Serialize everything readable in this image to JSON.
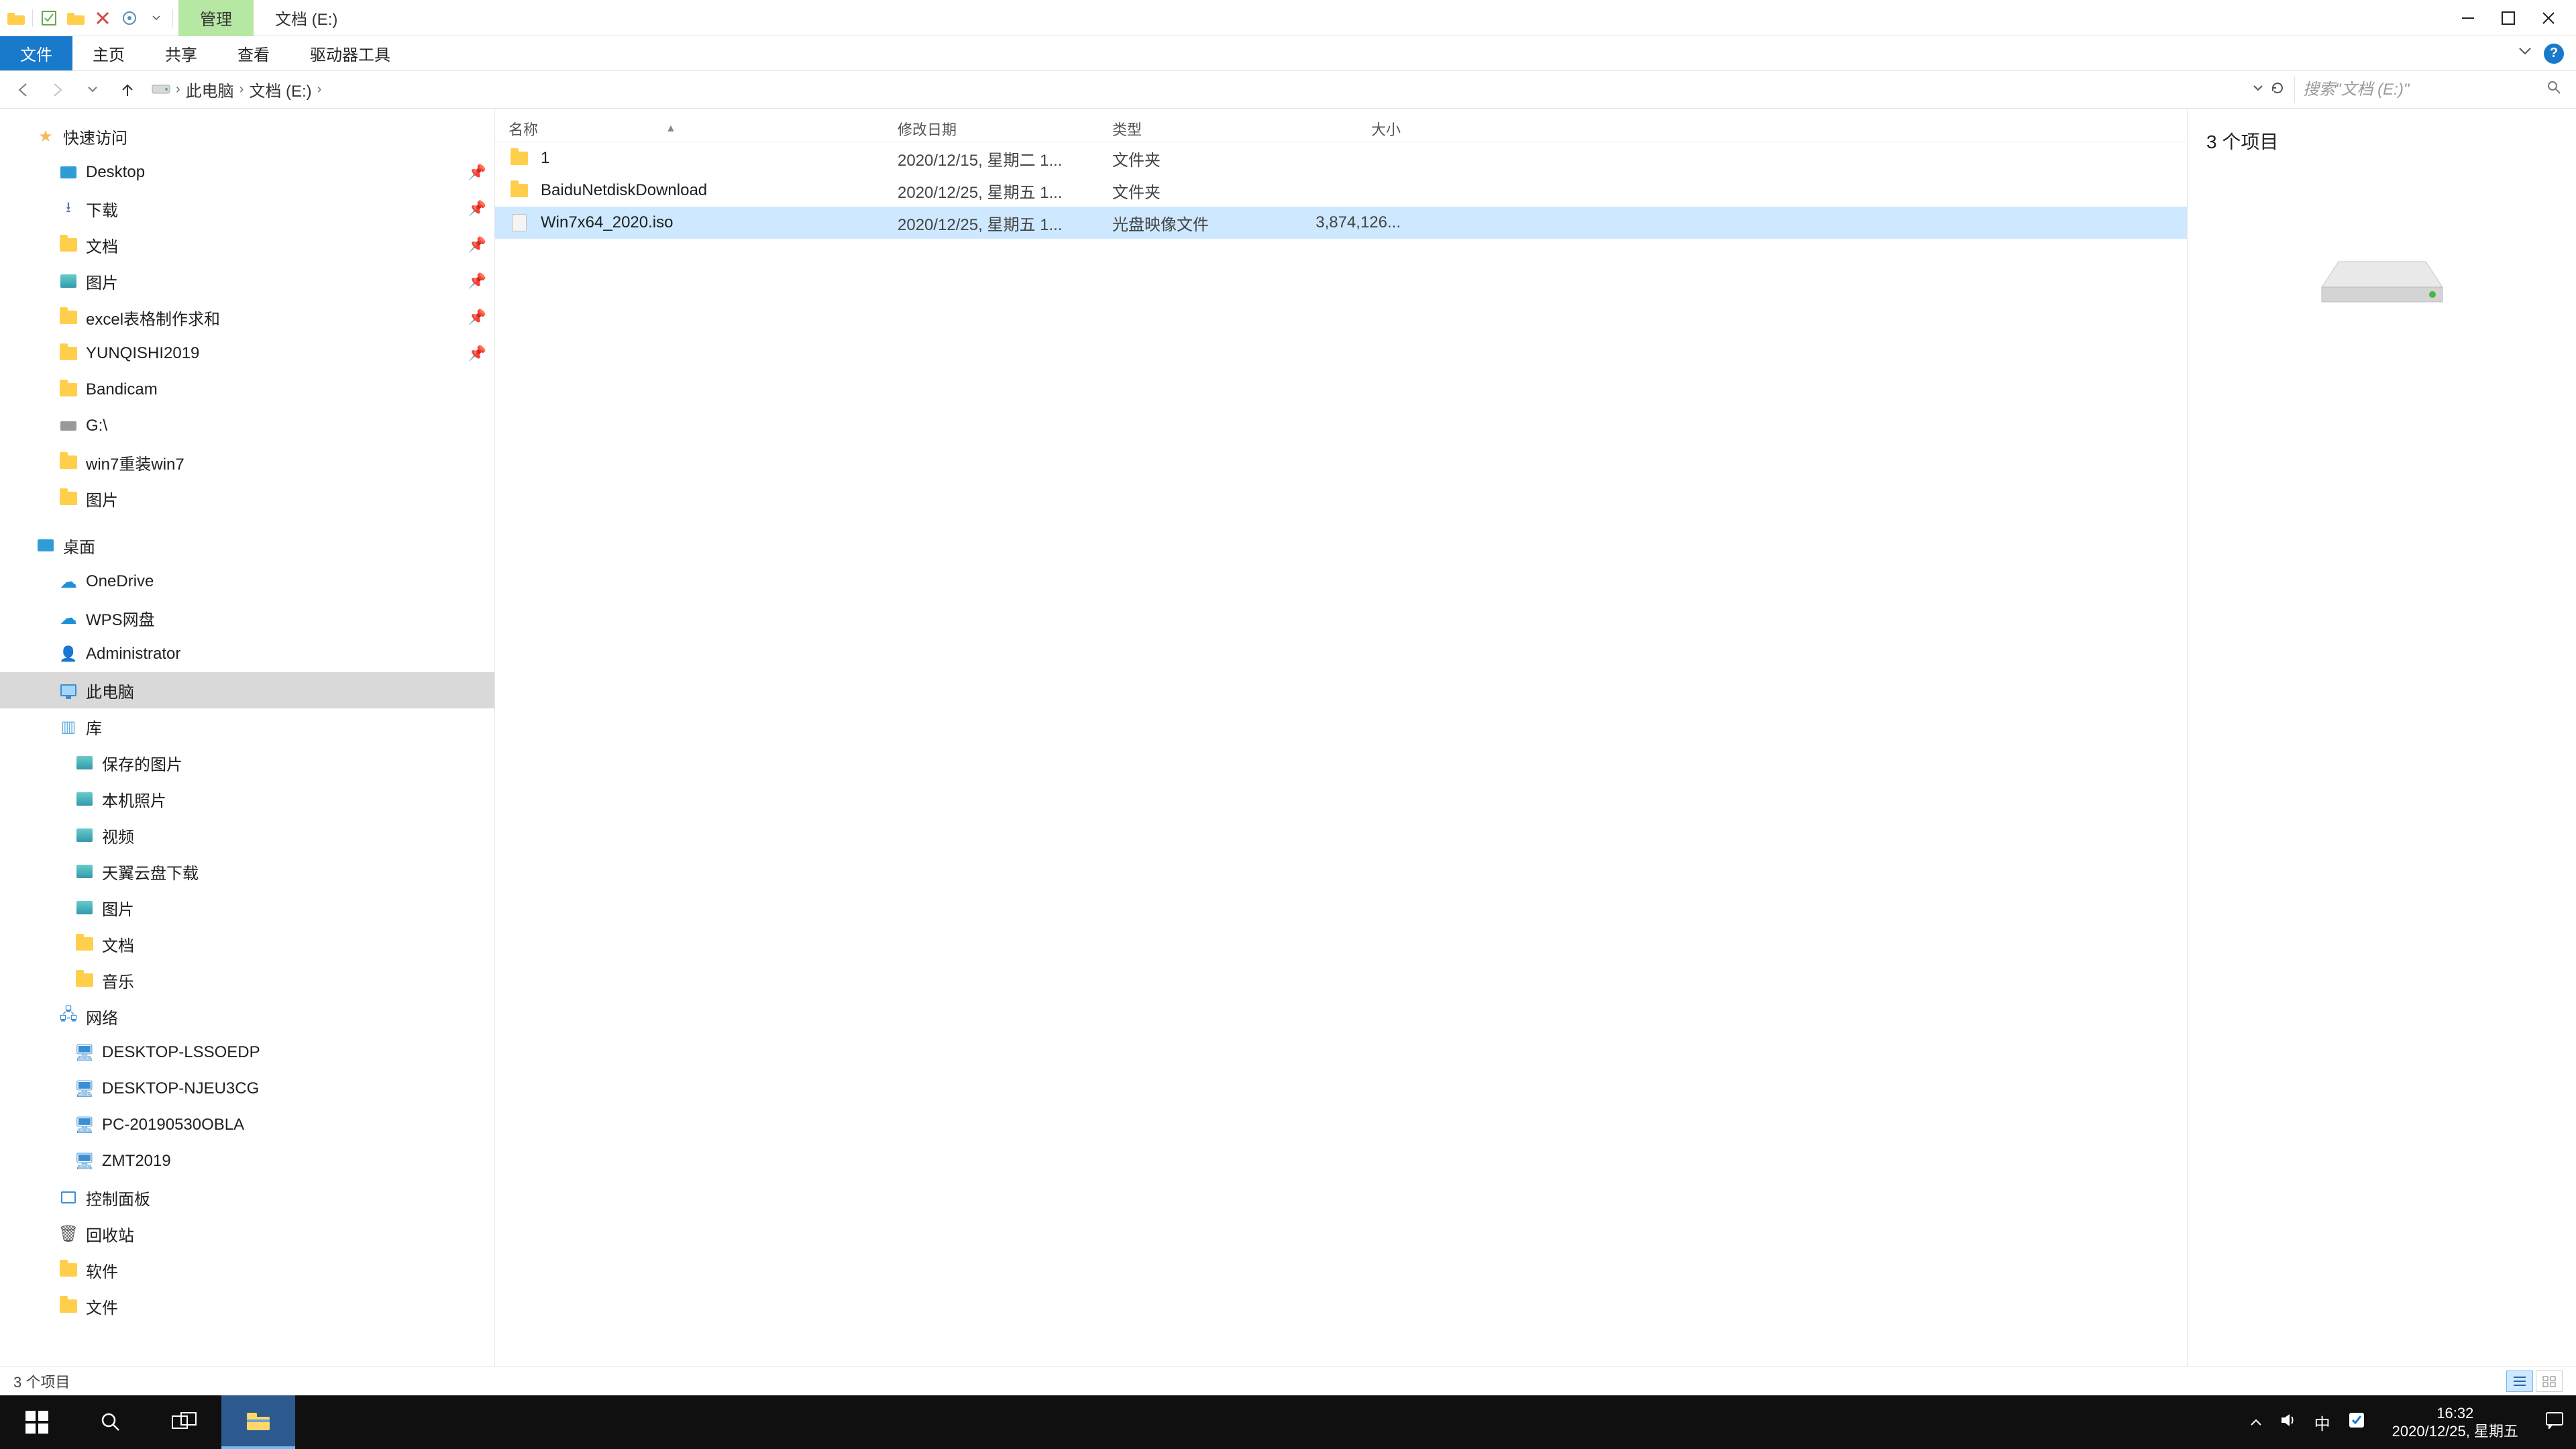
{
  "titlebar": {
    "manage_tab": "管理",
    "path_tab": "文档 (E:)"
  },
  "ribbon": {
    "file": "文件",
    "home": "主页",
    "share": "共享",
    "view": "查看",
    "drive_tools": "驱动器工具"
  },
  "breadcrumbs": {
    "this_pc": "此电脑",
    "drive": "文档 (E:)"
  },
  "search": {
    "placeholder": "搜索\"文档 (E:)\""
  },
  "columns": {
    "name": "名称",
    "date": "修改日期",
    "type": "类型",
    "size": "大小"
  },
  "rows": [
    {
      "name": "1",
      "date": "2020/12/15, 星期二 1...",
      "type": "文件夹",
      "size": "",
      "icon": "folder",
      "selected": false
    },
    {
      "name": "BaiduNetdiskDownload",
      "date": "2020/12/25, 星期五 1...",
      "type": "文件夹",
      "size": "",
      "icon": "folder",
      "selected": false
    },
    {
      "name": "Win7x64_2020.iso",
      "date": "2020/12/25, 星期五 1...",
      "type": "光盘映像文件",
      "size": "3,874,126...",
      "icon": "file",
      "selected": true
    }
  ],
  "nav": {
    "quick_access": "快速访问",
    "quick": [
      {
        "label": "Desktop",
        "icon": "desktop",
        "pin": true
      },
      {
        "label": "下载",
        "icon": "down",
        "pin": true
      },
      {
        "label": "文档",
        "icon": "folder",
        "pin": true
      },
      {
        "label": "图片",
        "icon": "img",
        "pin": true
      },
      {
        "label": "excel表格制作求和",
        "icon": "folder",
        "pin": true
      },
      {
        "label": "YUNQISHI2019",
        "icon": "folder",
        "pin": true
      },
      {
        "label": "Bandicam",
        "icon": "folder",
        "pin": false
      },
      {
        "label": "G:\\",
        "icon": "usb",
        "pin": false
      },
      {
        "label": "win7重装win7",
        "icon": "folder",
        "pin": false
      },
      {
        "label": "图片",
        "icon": "folder",
        "pin": false
      }
    ],
    "desktop_root": "桌面",
    "desktop": [
      {
        "label": "OneDrive",
        "icon": "onedrive"
      },
      {
        "label": "WPS网盘",
        "icon": "onedrive"
      },
      {
        "label": "Administrator",
        "icon": "user"
      },
      {
        "label": "此电脑",
        "icon": "monitor",
        "selected": true
      },
      {
        "label": "库",
        "icon": "lib"
      }
    ],
    "libraries": [
      {
        "label": "保存的图片",
        "icon": "img"
      },
      {
        "label": "本机照片",
        "icon": "img"
      },
      {
        "label": "视频",
        "icon": "img"
      },
      {
        "label": "天翼云盘下载",
        "icon": "img"
      },
      {
        "label": "图片",
        "icon": "img"
      },
      {
        "label": "文档",
        "icon": "folder"
      },
      {
        "label": "音乐",
        "icon": "folder"
      }
    ],
    "network_root": "网络",
    "network": [
      {
        "label": "DESKTOP-LSSOEDP",
        "icon": "pc"
      },
      {
        "label": "DESKTOP-NJEU3CG",
        "icon": "pc"
      },
      {
        "label": "PC-20190530OBLA",
        "icon": "pc"
      },
      {
        "label": "ZMT2019",
        "icon": "pc"
      }
    ],
    "extra": [
      {
        "label": "控制面板",
        "icon": "panel"
      },
      {
        "label": "回收站",
        "icon": "recycle"
      },
      {
        "label": "软件",
        "icon": "folder"
      },
      {
        "label": "文件",
        "icon": "folder"
      }
    ]
  },
  "preview": {
    "count_label": "3 个项目"
  },
  "status": {
    "label": "3 个项目"
  },
  "tray": {
    "ime": "中",
    "time": "16:32",
    "date": "2020/12/25, 星期五"
  }
}
